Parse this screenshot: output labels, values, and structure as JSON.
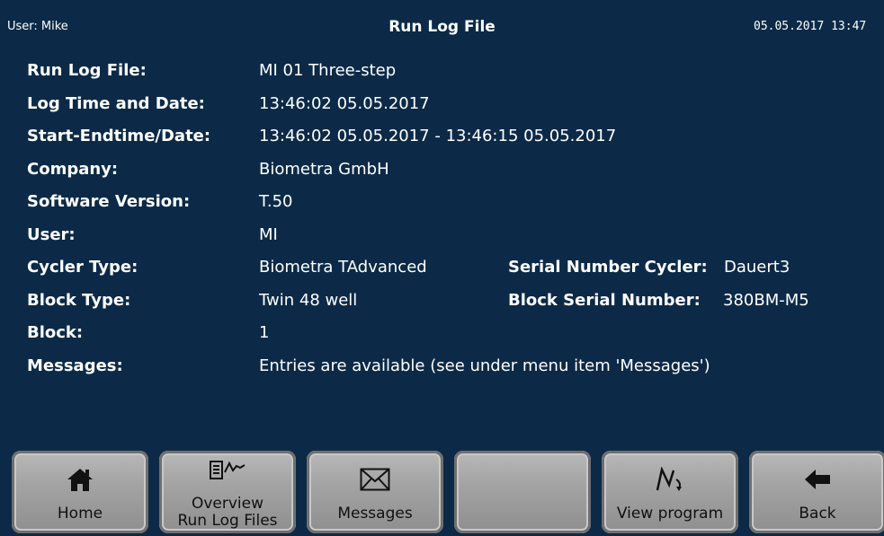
{
  "titlebar": {
    "user": "User: Mike",
    "title": "Run Log File",
    "datetime": "05.05.2017 13:47"
  },
  "info": {
    "run_log_file": {
      "label": "Run Log File:",
      "value": "MI 01 Three-step"
    },
    "log_time_date": {
      "label": "Log Time and Date:",
      "value": "13:46:02 05.05.2017"
    },
    "start_end": {
      "label": "Start-Endtime/Date:",
      "value": "13:46:02 05.05.2017 - 13:46:15 05.05.2017"
    },
    "company": {
      "label": "Company:",
      "value": "Biometra GmbH"
    },
    "software_version": {
      "label": "Software Version:",
      "value": "T.50"
    },
    "user": {
      "label": "User:",
      "value": "MI"
    },
    "cycler_type": {
      "label": "Cycler Type:",
      "value": "Biometra TAdvanced"
    },
    "serial_number_cycler": {
      "label": "Serial Number Cycler:",
      "value": "Dauert3"
    },
    "block_type": {
      "label": "Block Type:",
      "value": "Twin 48 well"
    },
    "block_serial_number": {
      "label": "Block Serial Number:",
      "value": "380BM-M5"
    },
    "block": {
      "label": "Block:",
      "value": "1"
    },
    "messages": {
      "label": "Messages:",
      "value": "Entries are available (see under menu item 'Messages')"
    }
  },
  "buttons": {
    "home": {
      "label": "Home",
      "icon": "home-icon"
    },
    "overview": {
      "label_line1": "Overview",
      "label_line2": "Run Log Files",
      "icon": "log-chart-icon"
    },
    "messages": {
      "label": "Messages",
      "icon": "envelope-icon"
    },
    "empty": {
      "label": ""
    },
    "view_program": {
      "label": "View program",
      "icon": "program-curve-icon"
    },
    "back": {
      "label": "Back",
      "icon": "back-arrow-icon"
    }
  },
  "colors": {
    "background": "#0c2a47",
    "text": "#ffffff",
    "button": "#a4a4a4"
  }
}
